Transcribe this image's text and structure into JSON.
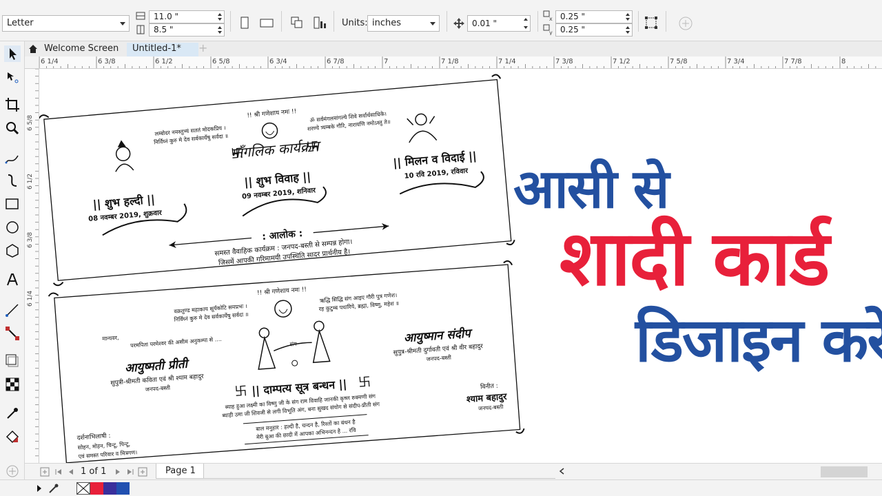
{
  "propbar": {
    "paper_size": "Letter",
    "width_value": "11.0 \"",
    "height_value": "8.5 \"",
    "units_label": "Units:",
    "units_value": "inches",
    "nudge_value": "0.01 \"",
    "dup_x": "0.25 \"",
    "dup_y": "0.25 \""
  },
  "tabs": {
    "welcome": "Welcome Screen",
    "document": "Untitled-1*",
    "add": "+"
  },
  "ruler": {
    "h_labels": [
      "6 1/4",
      "6 3/8",
      "6 1/2",
      "6 5/8",
      "6 3/4",
      "6 7/8",
      "7",
      "7 1/8",
      "7 1/4",
      "7 3/8",
      "7 1/2",
      "7 5/8",
      "7 3/4",
      "7 7/8",
      "8"
    ],
    "v_labels": [
      "6 5/8",
      "6 1/2",
      "6 3/8",
      "6 1/4"
    ]
  },
  "card1": {
    "invocation": "!! श्री गणेशाय नमः !!",
    "shloka_left_1": "लम्बोदर नमस्तुभ्यं सततं मोदकप्रिय ।",
    "shloka_left_2": "निर्विघ्नं कुरु मे देव सर्वकार्येषु सर्वदा ॥",
    "shloka_right_1": "ॐ सर्वमंगलमांगल्ये शिवे सर्वार्थसाधिके।",
    "shloka_right_2": "शरण्ये त्र्यम्बके गौरि, नारायणि नमोऽस्तु ते॥",
    "title": "माँगलिक कार्यक्रम",
    "haldi_title": "|| शुभ हल्दी ||",
    "haldi_date": "08 नवम्बर 2019, शुक्रवार",
    "vivah_title": "|| शुभ विवाह ||",
    "vivah_date": "09 नवम्बर 2019, शनिवार",
    "vidai_title": "|| मिलन व विदाई ||",
    "vidai_date": "10 रवि 2019, रविवार",
    "host": ": आलोक :",
    "note_1": "समस्त वैवाहिक कार्यक्रम : जनपद-बस्ती से सम्पन्न होगा।",
    "note_2": "जिसमें आपकी गरिमामयी उपस्थिति सादर प्रार्थनीय है।"
  },
  "card2": {
    "invocation": "!! श्री गणेशाय नमः !!",
    "shloka_left_1": "वक्रतुण्ड महाकाय सूर्यकोटि समप्रभः ।",
    "shloka_left_2": "निर्विघ्नं कुरु मे देव सर्वकार्येषु सर्वदा ॥",
    "shloka_right_1": "ऋद्धि सिद्धि संग आइए गौरी पुत्र गणेश।",
    "shloka_right_2": "रह कुटुम्ब पधारिये, ब्रह्मा, विष्णु, महेश ॥",
    "greeting_1": "मान्यवर,",
    "greeting_2": "परमपिता परमेश्वर की असीम अनुकम्पा से ....",
    "sang": "संग",
    "bride_name": "आयुष्मती प्रीती",
    "bride_parents": "सुपुत्री-श्रीमती कविता एवं श्री श्याम बहादुर",
    "bride_place": "जनपद-बस्ती",
    "groom_name": "आयुष्मान संदीप",
    "groom_parents": "सुपुत्र-श्रीमती दुर्गावती एवं श्री वीर बहादुर",
    "groom_place": "जनपद-बस्ती",
    "bandhan": "|| दाम्पत्य सूत्र बन्धन ||",
    "verse_1": "ब्याह हुआ लक्ष्मी का विष्णु जी के संग राम विवाहि जानकी कृष्ण रुक्मणी संग",
    "verse_2": "ब्याही उमा जी शिवजी से लगी विभूति अंग, बना सुखद संयोग से संदीप-प्रीती संग",
    "darshan_title": "दर्शनाभिलाषी :",
    "darshan_1": "सोहन, मोहन, चिन्टू, पिन्टू,",
    "darshan_2": "एवं समस्त परिवार व मित्रगण।",
    "vineet": "विनीत :",
    "vineet_name": "श्याम बहादुर",
    "vineet_place": "जनपद-बस्ती",
    "manuhar_1": "बाल मनुहार : हल्दी है, चन्दन है, रिश्तों का बंधन है",
    "manuhar_2": "मेरी बुआ की छादी में आपका अभिनन्दन है ... रवि"
  },
  "overlay": {
    "line1": "आसी से",
    "line2": "शादी कार्ड",
    "line3": "डिजाइन करें ..",
    "color_blue": "#2350a0",
    "color_red": "#e8203a"
  },
  "pagebar": {
    "page_counter": "1 of 1",
    "page_tab": "Page 1"
  },
  "palette": [
    "#ffffff",
    "#e8203a",
    "#3a2f9c",
    "#2150b0"
  ]
}
